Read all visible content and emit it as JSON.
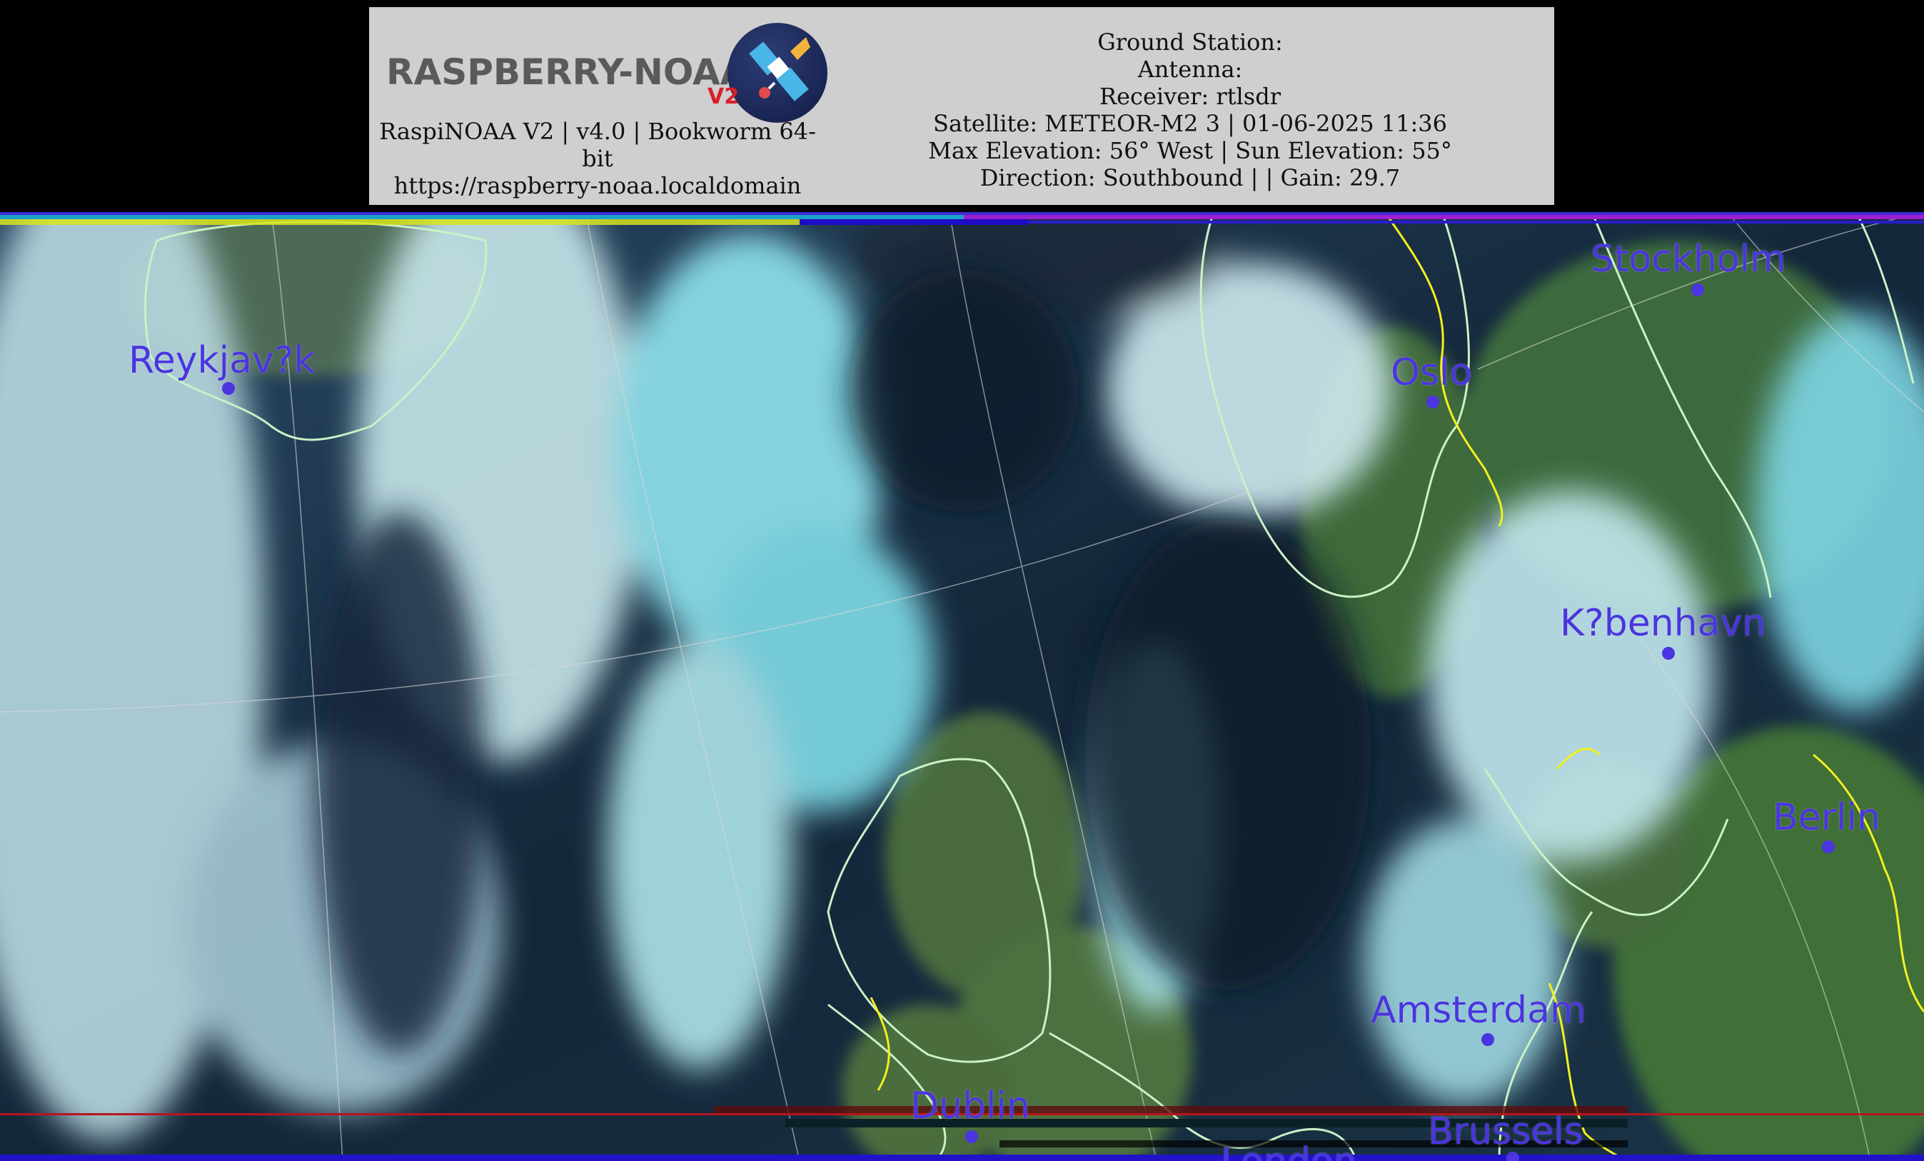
{
  "header": {
    "logo": {
      "wordmark": "RASPBERRY-NOAA",
      "version_badge": "V2",
      "icon": "satellite-icon"
    },
    "left_lines": [
      "RaspiNOAA V2 | v4.0 | Bookworm 64-",
      "bit",
      "https://raspberry-noaa.localdomain"
    ],
    "right_lines": [
      "Ground Station:",
      "Antenna:",
      "Receiver: rtlsdr",
      "Satellite: METEOR-M2 3 | 01-06-2025 11:36",
      "Max Elevation: 56° West | Sun Elevation: 55°",
      "Direction: Southbound | | Gain: 29.7"
    ]
  },
  "map": {
    "cities": [
      {
        "name": "Reykjav?k"
      },
      {
        "name": "Oslo"
      },
      {
        "name": "Stockholm"
      },
      {
        "name": "K?benhavn"
      },
      {
        "name": "Berlin"
      },
      {
        "name": "Amsterdam"
      },
      {
        "name": "Dublin"
      },
      {
        "name": "Brussels"
      },
      {
        "name": "London"
      }
    ],
    "colors": {
      "city_label": "#4a35e0",
      "coastline": "#c9f2c6",
      "border": "#f4f020",
      "cloud": "#bff3f6",
      "ocean": "#0f1f2e",
      "land": "#3f6a3a"
    }
  }
}
